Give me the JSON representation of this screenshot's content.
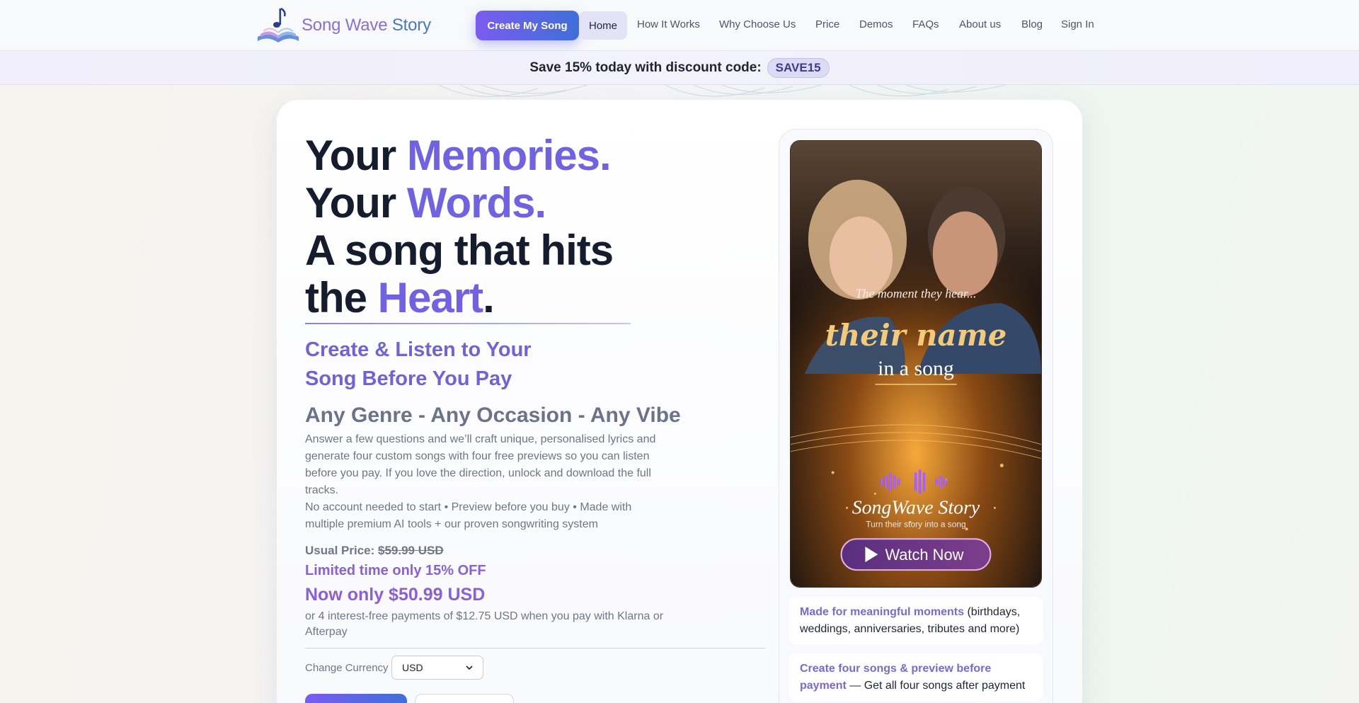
{
  "nav": {
    "logo": {
      "part1": "Song Wave",
      "part2": "Story"
    },
    "cta_label": "Create My Song",
    "links": [
      "Home",
      "How It Works",
      "Why Choose Us",
      "Price",
      "Demos",
      "FAQs",
      "About us",
      "Blog",
      "Sign In"
    ],
    "active": "Home"
  },
  "promo": {
    "text": "Save 15% today with discount code:",
    "code": "SAVE15"
  },
  "hero": {
    "line1_a": "Your ",
    "line1_b": "Memories.",
    "line2_a": "Your ",
    "line2_b": "Words.",
    "line3": "A song that hits",
    "line4_a": "the ",
    "line4_b": "Heart",
    "line4_c": ".",
    "sub1_line1": "Create & Listen to Your",
    "sub1_line2": "Song Before You Pay",
    "sub2": "Any Genre - Any Occasion - Any Vibe",
    "para1": "Answer a few questions and we’ll craft unique, personalised lyrics and generate four custom songs with four free previews so you can listen before you pay. If you love the direction, unlock and download the full tracks.",
    "para2": "No account needed to start • Preview before you buy • Made with multiple premium AI tools + our proven songwriting system"
  },
  "pricing": {
    "usual_label": "Usual Price:",
    "usual_value": "$59.99 USD",
    "limited": "Limited time only 15% OFF",
    "now": "Now only $50.99 USD",
    "klarna": "or 4 interest-free payments of $12.75 USD when you pay with Klarna or Afterpay",
    "currency_label": "Change Currency",
    "currency_value": "USD"
  },
  "video": {
    "tagline1": "The moment they hear...",
    "tagline2": "their name",
    "tagline3": "in a song",
    "brand": "SongWave Story",
    "brand_sub": "Turn their story into a song",
    "button": "Watch Now"
  },
  "features": [
    {
      "highlight": "Made for meaningful moments",
      "rest": " (birthdays, weddings, anniversaries, tributes and more)"
    },
    {
      "highlight": "Create four songs & preview before payment",
      "rest": " — Get all four songs after payment"
    }
  ],
  "colors": {
    "accent": "#7162e3",
    "cta_start": "#7a5cf0",
    "cta_end": "#3f6fd8",
    "heading": "#141c2e"
  }
}
